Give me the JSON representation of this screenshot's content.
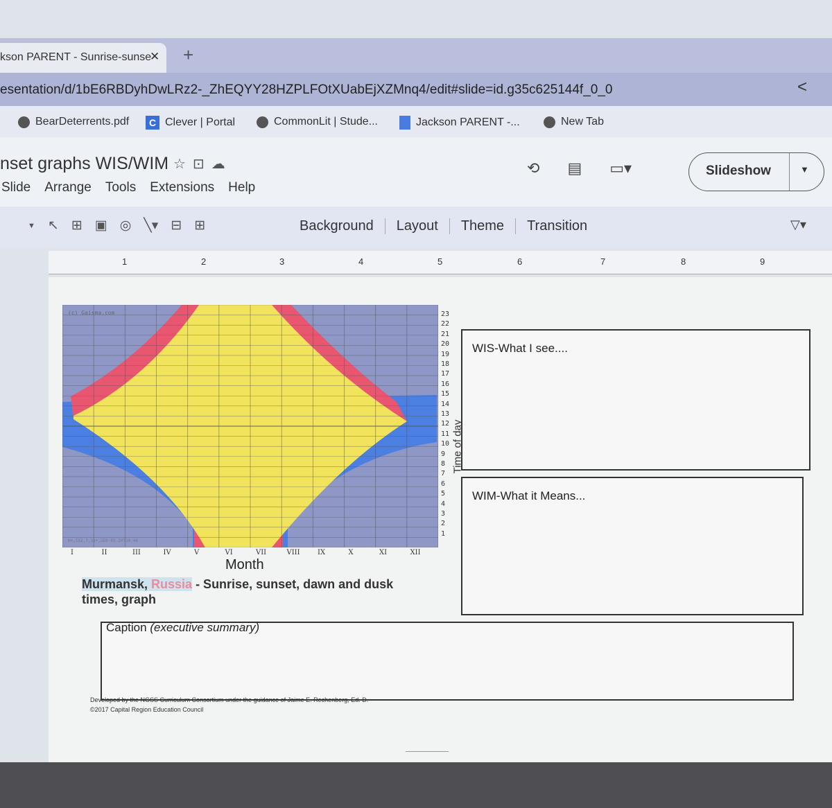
{
  "browser": {
    "tab_title": "kson PARENT - Sunrise-sunse",
    "tab_close": "✕",
    "new_tab": "+",
    "url": "esentation/d/1bE6RBDyhDwLRz2-_ZhEQYY28HZPLFOtXUabEjXZMnq4/edit#slide=id.g35c625144f_0_0",
    "share_icon": "share-icon",
    "bookmarks": [
      {
        "label": "BearDeterrents.pdf",
        "icon": "globe-icon"
      },
      {
        "label": "Clever | Portal",
        "icon": "clever-icon",
        "icon_text": "C"
      },
      {
        "label": "CommonLit | Stude...",
        "icon": "globe-icon"
      },
      {
        "label": "Jackson PARENT -...",
        "icon": "docs-icon"
      },
      {
        "label": "New Tab",
        "icon": "globe-icon"
      }
    ]
  },
  "app": {
    "title": "nset graphs WIS/WIM",
    "title_icons": [
      "star-icon",
      "move-to-folder-icon",
      "cloud-status-icon"
    ],
    "menus": [
      "Slide",
      "Arrange",
      "Tools",
      "Extensions",
      "Help"
    ],
    "right_icons": [
      "history-icon",
      "comments-icon",
      "meet-icon"
    ],
    "slideshow": "Slideshow"
  },
  "toolbar": {
    "tools": [
      "select-icon",
      "text-box-icon",
      "image-icon",
      "shapes-icon",
      "line-icon",
      "comment-icon",
      "add-icon"
    ],
    "text_buttons": [
      "Background",
      "Layout",
      "Theme",
      "Transition"
    ]
  },
  "ruler": [
    "1",
    "2",
    "3",
    "4",
    "5",
    "6",
    "7",
    "8",
    "9"
  ],
  "slide": {
    "chart": {
      "watermark": "(c) Gaisma.com",
      "footer_code": "N+,1X2,7,19+,2E0-02-20T10:46",
      "y_labels": [
        "23",
        "22",
        "21",
        "20",
        "19",
        "18",
        "17",
        "16",
        "15",
        "14",
        "13",
        "12",
        "11",
        "10",
        "9",
        "8",
        "7",
        "6",
        "5",
        "4",
        "3",
        "2",
        "1"
      ],
      "y_title": "Time of day",
      "x_labels": [
        "I",
        "II",
        "III",
        "IV",
        "V",
        "VI",
        "VII",
        "VIII",
        "IX",
        "X",
        "XI",
        "XII"
      ],
      "x_title": "Month",
      "colors": {
        "night": "#8f97c6",
        "daylight": "#f1e45c",
        "dawn_dusk_red": "#e9566f",
        "twilight_blue": "#4b7fe2"
      }
    },
    "caption_title": {
      "part1": "Murmansk, ",
      "link": "Russia",
      "part2": " - Sunrise, sunset, dawn and dusk times, graph"
    },
    "wis_label": "WIS-What I see....",
    "wim_label": "WIM-What it Means...",
    "caption_label": "Caption",
    "caption_hint": "(executive summary)",
    "credit_line1": "Developed by the NGSS Curriculum Consortium under the guidance of Jaime E. Rechenberg, Ed. D.",
    "credit_line2": "©2017 Capital Region Education Council"
  }
}
